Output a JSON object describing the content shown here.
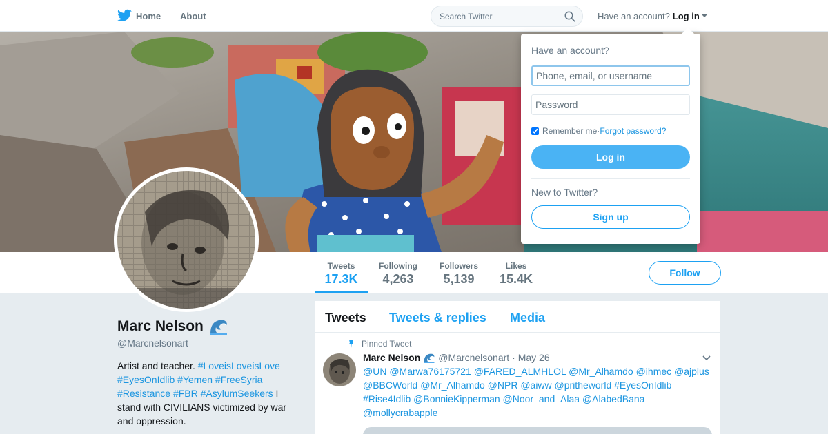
{
  "nav": {
    "home_label": "Home",
    "about_label": "About",
    "search_placeholder": "Search Twitter",
    "have_account_text": "Have an account?",
    "login_label": "Log in"
  },
  "stats": [
    {
      "label": "Tweets",
      "value": "17.3K"
    },
    {
      "label": "Following",
      "value": "4,263"
    },
    {
      "label": "Followers",
      "value": "5,139"
    },
    {
      "label": "Likes",
      "value": "15.4K"
    }
  ],
  "follow_label": "Follow",
  "profile": {
    "name": "Marc Nelson",
    "handle": "@Marcnelsonart",
    "bio_parts": [
      "Artist and teacher. ",
      "#LoveisLoveisLove",
      "#EyesOnIdlib",
      "#Yemen",
      "#FreeSyria",
      "#Resistance",
      "#FBR",
      "#AsylumSeekers",
      " I stand with CIVILIANS victimized by war and oppression."
    ]
  },
  "tabs": [
    "Tweets",
    "Tweets & replies",
    "Media"
  ],
  "tweet": {
    "pinned_label": "Pinned Tweet",
    "name": "Marc Nelson",
    "handle": "@Marcnelsonart",
    "date": "· May 26",
    "text": "@UN @Marwa76175721 @FARED_ALMHLOL @Mr_Alhamdo @ihmec @ajplus @BBCWorld @Mr_Alhamdo @NPR @aiww @pritheworld #EyesOnIdlib #Rise4Idlib @BonnieKipperman @Noor_and_Alaa @AlabedBana @mollycrabapple"
  },
  "login_dropdown": {
    "heading": "Have an account?",
    "username_placeholder": "Phone, email, or username",
    "password_placeholder": "Password",
    "remember_label": "Remember me",
    "separator": " · ",
    "forgot_label": "Forgot password?",
    "login_button": "Log in",
    "new_heading": "New to Twitter?",
    "signup_button": "Sign up"
  },
  "colors": {
    "accent": "#1da1f2",
    "link": "#1b95e0",
    "login_button": "#4ab3f4",
    "page_bg": "#e6ecf0"
  },
  "icons": [
    "twitter-bird-icon",
    "search-icon",
    "caret-down-icon",
    "wave-emoji-icon",
    "pin-icon",
    "chevron-down-icon"
  ]
}
